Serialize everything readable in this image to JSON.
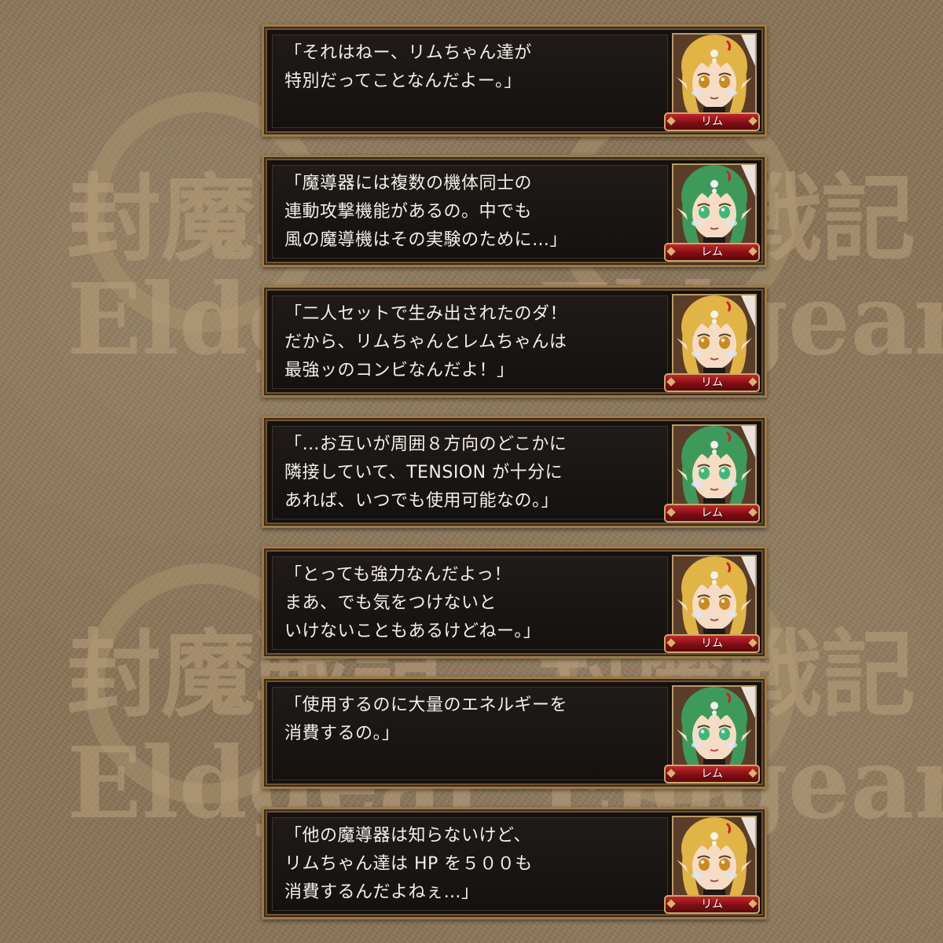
{
  "watermark": {
    "title_chars": [
      "封",
      "魔",
      "戦",
      "記"
    ],
    "subtitle": "Eldgear"
  },
  "dialogs": [
    {
      "speaker": "リム",
      "character": "rim",
      "text": "「それはねー、リムちゃん達が\n特別だってことなんだよー。」"
    },
    {
      "speaker": "レム",
      "character": "rem",
      "text": "「魔導器には複数の機体同士の\n連動攻撃機能があるの。中でも\n風の魔導機はその実験のために…」"
    },
    {
      "speaker": "リム",
      "character": "rim",
      "text": "「二人セットで生み出されたのダ！\nだから、リムちゃんとレムちゃんは\n最強ッのコンビなんだよ！」"
    },
    {
      "speaker": "レム",
      "character": "rem",
      "text": "「…お互いが周囲８方向のどこかに\n隣接していて、TENSION が十分に\nあれば、いつでも使用可能なの。」"
    },
    {
      "speaker": "リム",
      "character": "rim",
      "text": "「とっても強力なんだよっ！\nまあ、でも気をつけないと\nいけないこともあるけどねー。」"
    },
    {
      "speaker": "レム",
      "character": "rem",
      "text": "「使用するのに大量のエネルギーを\n消費するの。」"
    },
    {
      "speaker": "リム",
      "character": "rim",
      "text": "「他の魔導器は知らないけど、\nリムちゃん達は HP を５００も\n消費するんだよねぇ…」"
    }
  ],
  "colors": {
    "rim_hair": "#e0b445",
    "rim_eye": "#c98a1f",
    "rem_hair": "#3e9a5a",
    "rem_eye": "#3cb87a",
    "name_plate": "#a3151b",
    "frame_gold": "#9a7a4a"
  }
}
